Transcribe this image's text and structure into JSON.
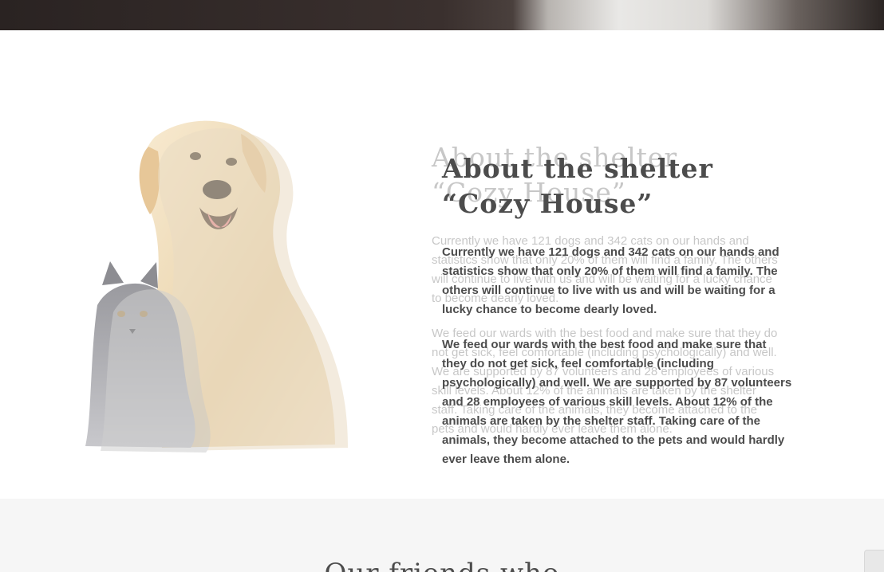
{
  "about": {
    "title_line1": "About the shelter",
    "title_line2": "“Cozy House”",
    "paragraph1": "Currently we have 121 dogs and 342 cats on our hands and statistics show that only 20% of them will find a family. The others will continue to live with us and will be waiting for a lucky chance to become dearly loved.",
    "paragraph2": "We feed our wards with the best food and make sure that they do not get sick, feel comfortable (including psychologically) and well. We are supported by 87 volunteers and 28 employees of various skill levels. About 12% of the animals are taken by the shelter staff. Taking care of the animals, they become attached to the pets and would hardly ever leave them alone.",
    "image_icon": "dog-and-cat-illustration"
  },
  "friends": {
    "title": "Our friends who"
  },
  "colors": {
    "text": "#545454",
    "muted_text": "#b5b5b5",
    "background": "#ffffff",
    "section_background": "#f6f6f6",
    "top_strip": "#2a2322"
  }
}
